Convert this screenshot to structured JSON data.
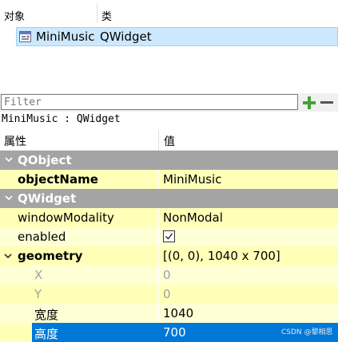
{
  "object_inspector": {
    "col_object": "对象",
    "col_class": "类",
    "row": {
      "object": "MiniMusic",
      "class": "QWidget",
      "icon": "widget-icon"
    }
  },
  "filter": {
    "placeholder": "Filter",
    "add_icon": "plus-icon",
    "remove_icon": "minus-icon"
  },
  "breadcrumb": "MiniMusic : QWidget",
  "property_table": {
    "col_property": "属性",
    "col_value": "值",
    "sections": {
      "qobject": "QObject",
      "qwidget": "QWidget"
    },
    "rows": {
      "objectName": {
        "name": "objectName",
        "value": "MiniMusic"
      },
      "windowModality": {
        "name": "windowModality",
        "value": "NonModal"
      },
      "enabled": {
        "name": "enabled",
        "value": true
      },
      "geometry": {
        "name": "geometry",
        "value": "[(0, 0), 1040 x 700]"
      },
      "x": {
        "name": "X",
        "value": "0"
      },
      "y": {
        "name": "Y",
        "value": "0"
      },
      "width": {
        "name": "宽度",
        "value": "1040"
      },
      "height": {
        "name": "高度",
        "value": "700"
      }
    }
  },
  "watermark": "CSDN @黎相思",
  "colors": {
    "section_bg": "#a4a4a4",
    "row_light": "#ffffd6",
    "row_dark": "#ffffb8",
    "selection": "#0078d7",
    "object_selection": "#cce8ff",
    "add_green": "#3fa532"
  }
}
